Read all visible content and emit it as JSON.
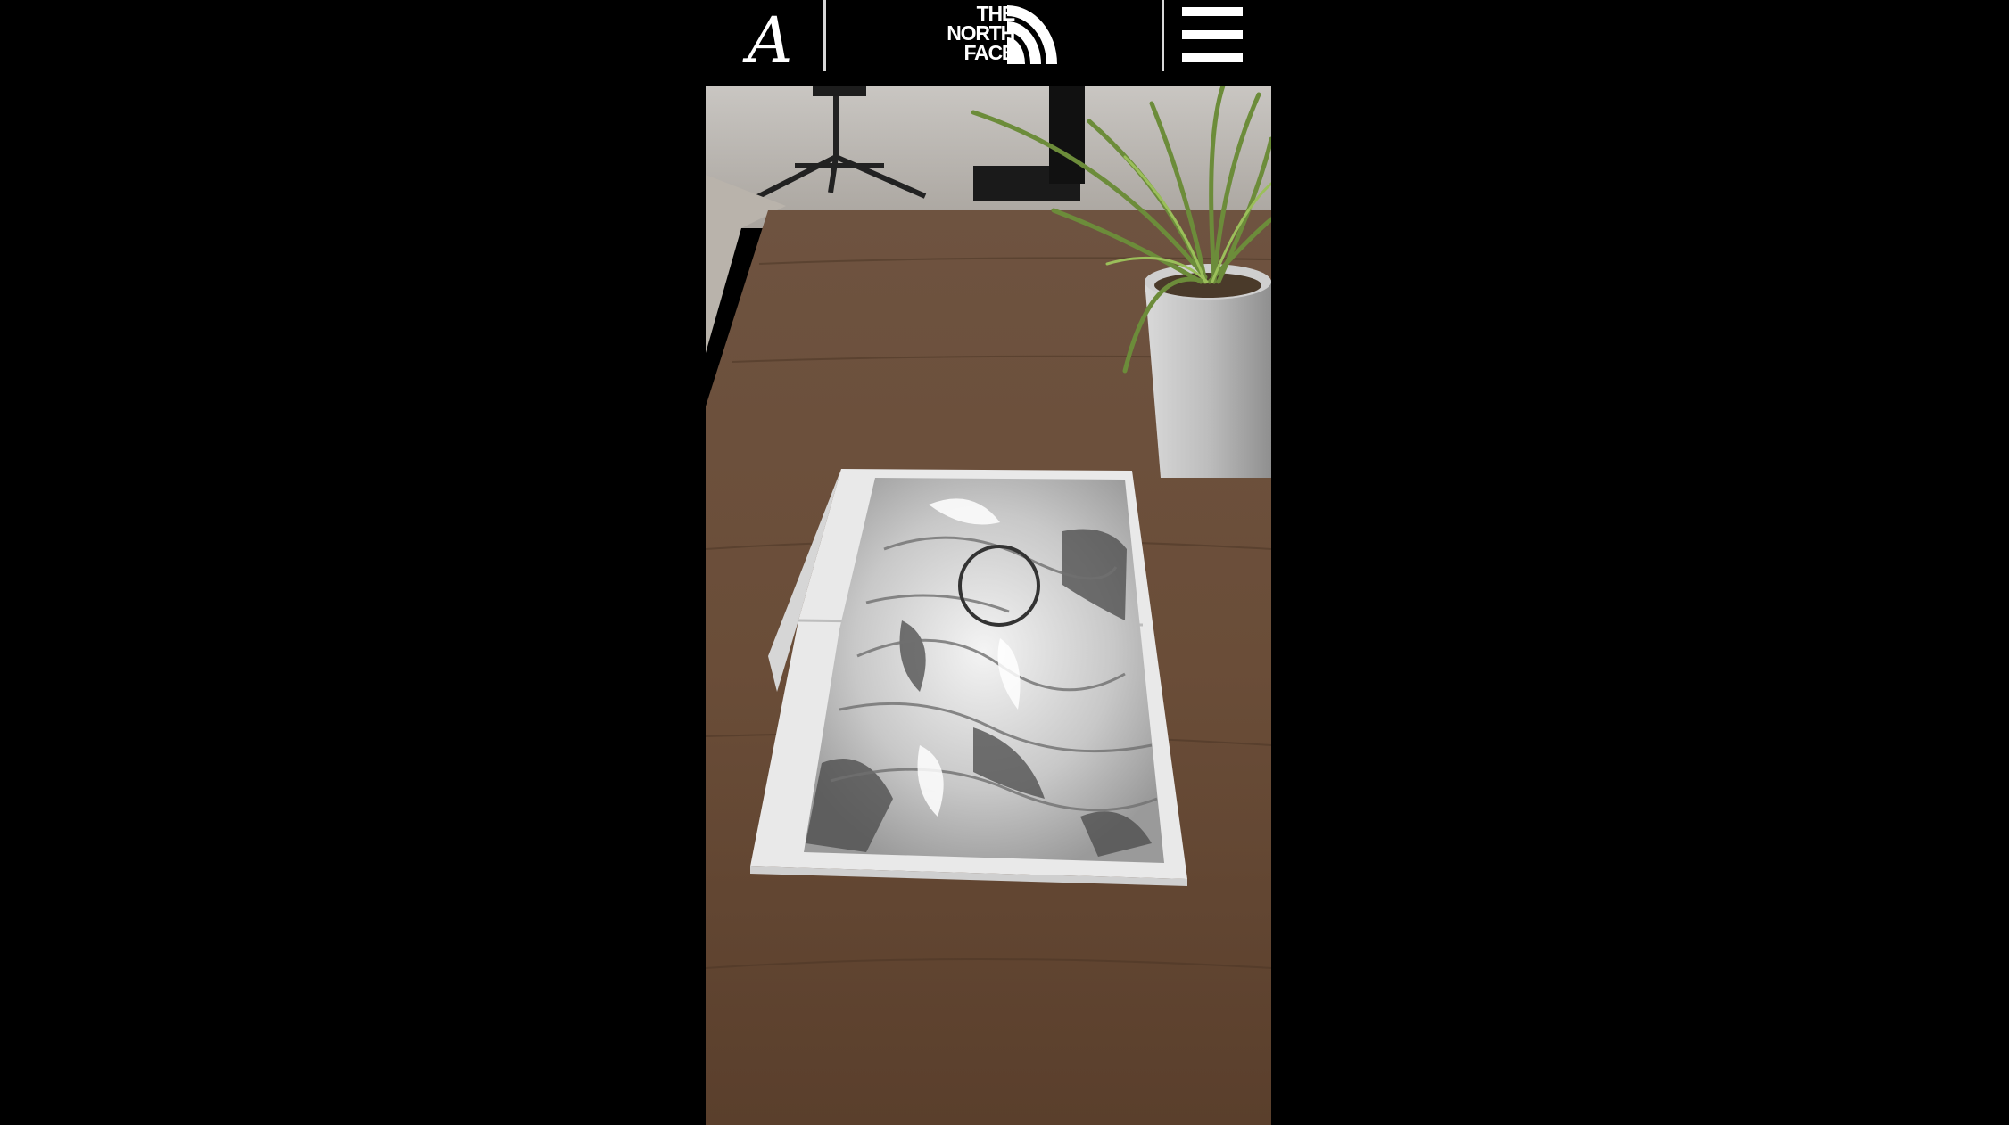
{
  "header": {
    "left_logo": "A",
    "brand_logo_lines": [
      "THE",
      "NORTH",
      "FACE"
    ]
  },
  "icons": {
    "menu": "hamburger-icon",
    "brand_mark": "half-dome-icon"
  },
  "colors": {
    "background": "#000000",
    "header_text": "#ffffff",
    "divider": "#d8d8d8"
  }
}
